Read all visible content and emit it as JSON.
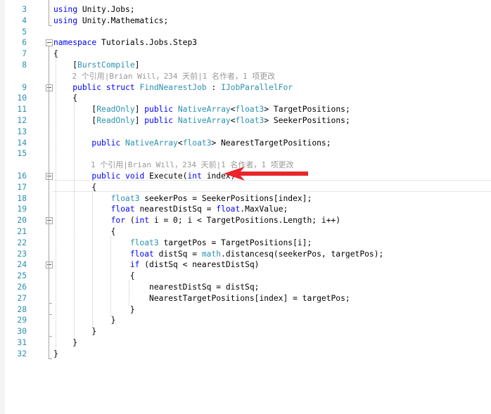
{
  "editor": {
    "lines": [
      {
        "n": "3",
        "parts": [
          {
            "t": "using",
            "c": "kw"
          },
          {
            "t": " Unity.Jobs;",
            "c": ""
          }
        ]
      },
      {
        "n": "4",
        "parts": [
          {
            "t": "using",
            "c": "kw"
          },
          {
            "t": " Unity.Mathematics;",
            "c": ""
          }
        ]
      },
      {
        "n": "5",
        "parts": []
      },
      {
        "n": "6",
        "parts": [
          {
            "t": "namespace",
            "c": "kw"
          },
          {
            "t": " Tutorials.Jobs.Step3",
            "c": ""
          }
        ]
      },
      {
        "n": "7",
        "parts": [
          {
            "t": "{",
            "c": ""
          }
        ]
      },
      {
        "n": "8",
        "parts": [
          {
            "t": "    [",
            "c": ""
          },
          {
            "t": "BurstCompile",
            "c": "ty"
          },
          {
            "t": "]",
            "c": ""
          }
        ]
      },
      {
        "lens": "    2 个引用|Brian Will，234 天前|1 名作者，1 项更改"
      },
      {
        "n": "9",
        "parts": [
          {
            "t": "    ",
            "c": ""
          },
          {
            "t": "public",
            "c": "kw"
          },
          {
            "t": " ",
            "c": ""
          },
          {
            "t": "struct",
            "c": "kw"
          },
          {
            "t": " ",
            "c": ""
          },
          {
            "t": "FindNearestJob",
            "c": "ty"
          },
          {
            "t": " : ",
            "c": ""
          },
          {
            "t": "IJobParallelFor",
            "c": "ty"
          }
        ]
      },
      {
        "n": "10",
        "parts": [
          {
            "t": "    {",
            "c": ""
          }
        ]
      },
      {
        "n": "11",
        "parts": [
          {
            "t": "        [",
            "c": ""
          },
          {
            "t": "ReadOnly",
            "c": "ty"
          },
          {
            "t": "] ",
            "c": ""
          },
          {
            "t": "public",
            "c": "kw"
          },
          {
            "t": " ",
            "c": ""
          },
          {
            "t": "NativeArray",
            "c": "ty"
          },
          {
            "t": "<",
            "c": ""
          },
          {
            "t": "float3",
            "c": "ty"
          },
          {
            "t": "> TargetPositions;",
            "c": ""
          }
        ]
      },
      {
        "n": "12",
        "parts": [
          {
            "t": "        [",
            "c": ""
          },
          {
            "t": "ReadOnly",
            "c": "ty"
          },
          {
            "t": "] ",
            "c": ""
          },
          {
            "t": "public",
            "c": "kw"
          },
          {
            "t": " ",
            "c": ""
          },
          {
            "t": "NativeArray",
            "c": "ty"
          },
          {
            "t": "<",
            "c": ""
          },
          {
            "t": "float3",
            "c": "ty"
          },
          {
            "t": "> SeekerPositions;",
            "c": ""
          }
        ]
      },
      {
        "n": "13",
        "parts": []
      },
      {
        "n": "14",
        "parts": [
          {
            "t": "        ",
            "c": ""
          },
          {
            "t": "public",
            "c": "kw"
          },
          {
            "t": " ",
            "c": ""
          },
          {
            "t": "NativeArray",
            "c": "ty"
          },
          {
            "t": "<",
            "c": ""
          },
          {
            "t": "float3",
            "c": "ty"
          },
          {
            "t": "> NearestTargetPositions;",
            "c": ""
          }
        ]
      },
      {
        "n": "15",
        "parts": []
      },
      {
        "lens": "        1 个引用|Brian Will，234 天前|1 名作者，1 项更改"
      },
      {
        "n": "16",
        "parts": [
          {
            "t": "        ",
            "c": ""
          },
          {
            "t": "public",
            "c": "kw"
          },
          {
            "t": " ",
            "c": ""
          },
          {
            "t": "void",
            "c": "kw"
          },
          {
            "t": " Execute(",
            "c": ""
          },
          {
            "t": "int",
            "c": "kw"
          },
          {
            "t": " index)",
            "c": ""
          }
        ]
      },
      {
        "n": "17",
        "parts": [
          {
            "t": "        {",
            "c": ""
          }
        ]
      },
      {
        "n": "18",
        "parts": [
          {
            "t": "            ",
            "c": ""
          },
          {
            "t": "float3",
            "c": "ty"
          },
          {
            "t": " seekerPos = SeekerPositions[index];",
            "c": ""
          }
        ]
      },
      {
        "n": "19",
        "parts": [
          {
            "t": "            ",
            "c": ""
          },
          {
            "t": "float",
            "c": "kw"
          },
          {
            "t": " nearestDistSq = ",
            "c": ""
          },
          {
            "t": "float",
            "c": "kw"
          },
          {
            "t": ".MaxValue;",
            "c": ""
          }
        ]
      },
      {
        "n": "20",
        "parts": [
          {
            "t": "            ",
            "c": ""
          },
          {
            "t": "for",
            "c": "kw"
          },
          {
            "t": " (",
            "c": ""
          },
          {
            "t": "int",
            "c": "kw"
          },
          {
            "t": " i = 0; i < TargetPositions.Length; i++)",
            "c": ""
          }
        ]
      },
      {
        "n": "21",
        "parts": [
          {
            "t": "            {",
            "c": ""
          }
        ]
      },
      {
        "n": "22",
        "parts": [
          {
            "t": "                ",
            "c": ""
          },
          {
            "t": "float3",
            "c": "ty"
          },
          {
            "t": " targetPos = TargetPositions[i];",
            "c": ""
          }
        ]
      },
      {
        "n": "23",
        "parts": [
          {
            "t": "                ",
            "c": ""
          },
          {
            "t": "float",
            "c": "kw"
          },
          {
            "t": " distSq = ",
            "c": ""
          },
          {
            "t": "math",
            "c": "ty"
          },
          {
            "t": ".distancesq(seekerPos, targetPos);",
            "c": ""
          }
        ]
      },
      {
        "n": "24",
        "parts": [
          {
            "t": "                ",
            "c": ""
          },
          {
            "t": "if",
            "c": "kw"
          },
          {
            "t": " (distSq < nearestDistSq)",
            "c": ""
          }
        ]
      },
      {
        "n": "25",
        "parts": [
          {
            "t": "                {",
            "c": ""
          }
        ]
      },
      {
        "n": "26",
        "parts": [
          {
            "t": "                    nearestDistSq = distSq;",
            "c": ""
          }
        ]
      },
      {
        "n": "27",
        "parts": [
          {
            "t": "                    NearestTargetPositions[index] = targetPos;",
            "c": ""
          }
        ]
      },
      {
        "n": "28",
        "parts": [
          {
            "t": "                }",
            "c": ""
          }
        ]
      },
      {
        "n": "29",
        "parts": [
          {
            "t": "            }",
            "c": ""
          }
        ]
      },
      {
        "n": "30",
        "parts": [
          {
            "t": "        }",
            "c": ""
          }
        ]
      },
      {
        "n": "31",
        "parts": [
          {
            "t": "    }",
            "c": ""
          }
        ]
      },
      {
        "n": "32",
        "parts": [
          {
            "t": "}",
            "c": ""
          }
        ]
      }
    ]
  },
  "colors": {
    "keyword": "#0000ff",
    "type": "#2b91af",
    "line_number": "#2b91af",
    "codelens": "#999999",
    "arrow": "#e8262b"
  },
  "annotation": {
    "icon": "red-arrow-icon"
  }
}
